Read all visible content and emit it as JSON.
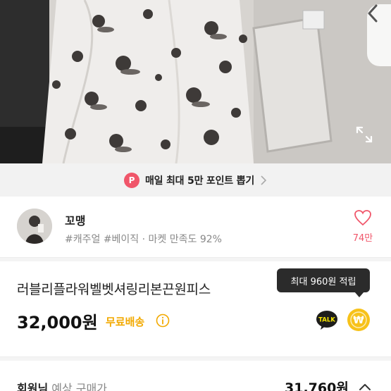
{
  "promo": {
    "badge": "P",
    "text": "매일 최대 5만 포인트 뽑기"
  },
  "seller": {
    "name": "꼬맹",
    "tags": "#캐주얼 #베이직 · 마켓 만족도 92%",
    "like_count": "74만"
  },
  "product": {
    "title": "러블리플라워벨벳셔링리본끈원피스",
    "price": "32,000원",
    "shipping": "무료배송"
  },
  "tooltip": {
    "text": "최대 960원 적립"
  },
  "actions": {
    "talk_label": "TALK",
    "pay_symbol": "₩"
  },
  "member": {
    "label_bold": "회원님",
    "label_rest": " 예상 구매가",
    "price": "31,760원"
  },
  "colors": {
    "accent_pink": "#f0566a",
    "shipping_yellow": "#f2a900",
    "pay_yellow": "#f7c21a"
  },
  "icons": [
    "back-chevron-icon",
    "expand-icon",
    "heart-icon",
    "info-icon",
    "kakao-talk-icon",
    "won-coin-icon",
    "chevron-right-icon",
    "chevron-up-icon"
  ]
}
